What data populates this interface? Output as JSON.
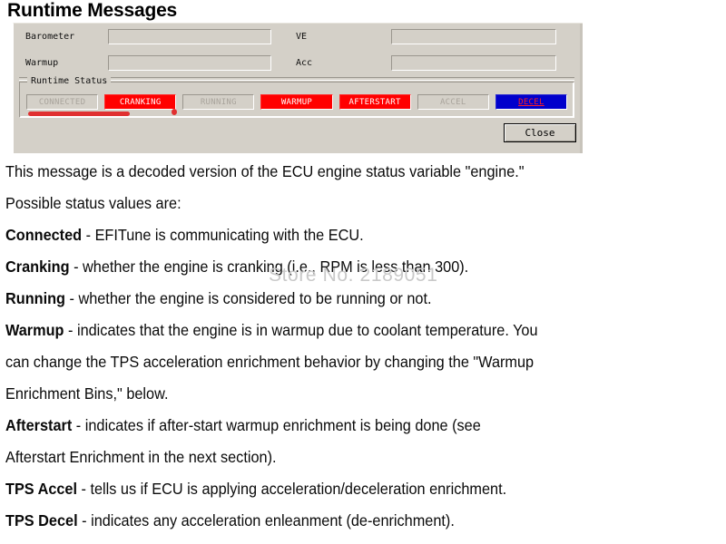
{
  "page": {
    "title": "Runtime Messages",
    "watermark": "Store No. 2189051"
  },
  "dialog": {
    "fields": [
      {
        "label": "Barometer",
        "value": ""
      },
      {
        "label": "VE",
        "value": ""
      },
      {
        "label": "Warmup",
        "value": ""
      },
      {
        "label": "Acc",
        "value": ""
      }
    ],
    "status_group": {
      "legend": "Runtime Status",
      "buttons": [
        {
          "label": "CONNECTED",
          "state": "off"
        },
        {
          "label": "CRANKING",
          "state": "on-red"
        },
        {
          "label": "RUNNING",
          "state": "off"
        },
        {
          "label": "WARMUP",
          "state": "on-red"
        },
        {
          "label": "AFTERSTART",
          "state": "on-red"
        },
        {
          "label": "ACCEL",
          "state": "off"
        },
        {
          "label": "DECEL",
          "state": "on-blue"
        }
      ]
    },
    "close_label": "Close"
  },
  "colors": {
    "dialog_face": "#d4d0c8",
    "active_red": "#ff0000",
    "active_blue": "#0000cc",
    "decel_text_red": "#ff2020",
    "inactive_text": "#a9a49c",
    "annotation_red": "#e03030",
    "watermark_gray": "#c9c9c9"
  },
  "body": {
    "lines": [
      "This message is a decoded version of the ECU engine status variable \"engine.\"",
      "Possible status values are:"
    ],
    "items": [
      {
        "term": "Connected",
        "rest": " - EFITune is communicating with the ECU."
      },
      {
        "term": "Cranking",
        "rest": " - whether the engine is cranking (i.e., RPM is less than 300)."
      },
      {
        "term": "Running",
        "rest": " - whether the engine is considered to be running or not."
      },
      {
        "term": "Warmup",
        "rest": " - indicates that the engine is in warmup due to coolant temperature. You"
      },
      {
        "term": "",
        "rest": "can change the TPS acceleration enrichment behavior by changing the \"Warmup"
      },
      {
        "term": "",
        "rest": "Enrichment Bins,\" below."
      },
      {
        "term": "Afterstart",
        "rest": " - indicates if after-start warmup enrichment is being done (see"
      },
      {
        "term": "",
        "rest": "Afterstart Enrichment in the next section)."
      },
      {
        "term": "TPS Accel",
        "rest": " - tells us if ECU is applying acceleration/deceleration enrichment."
      },
      {
        "term": "TPS Decel",
        "rest": " - indicates any acceleration enleanment (de-enrichment)."
      }
    ]
  }
}
